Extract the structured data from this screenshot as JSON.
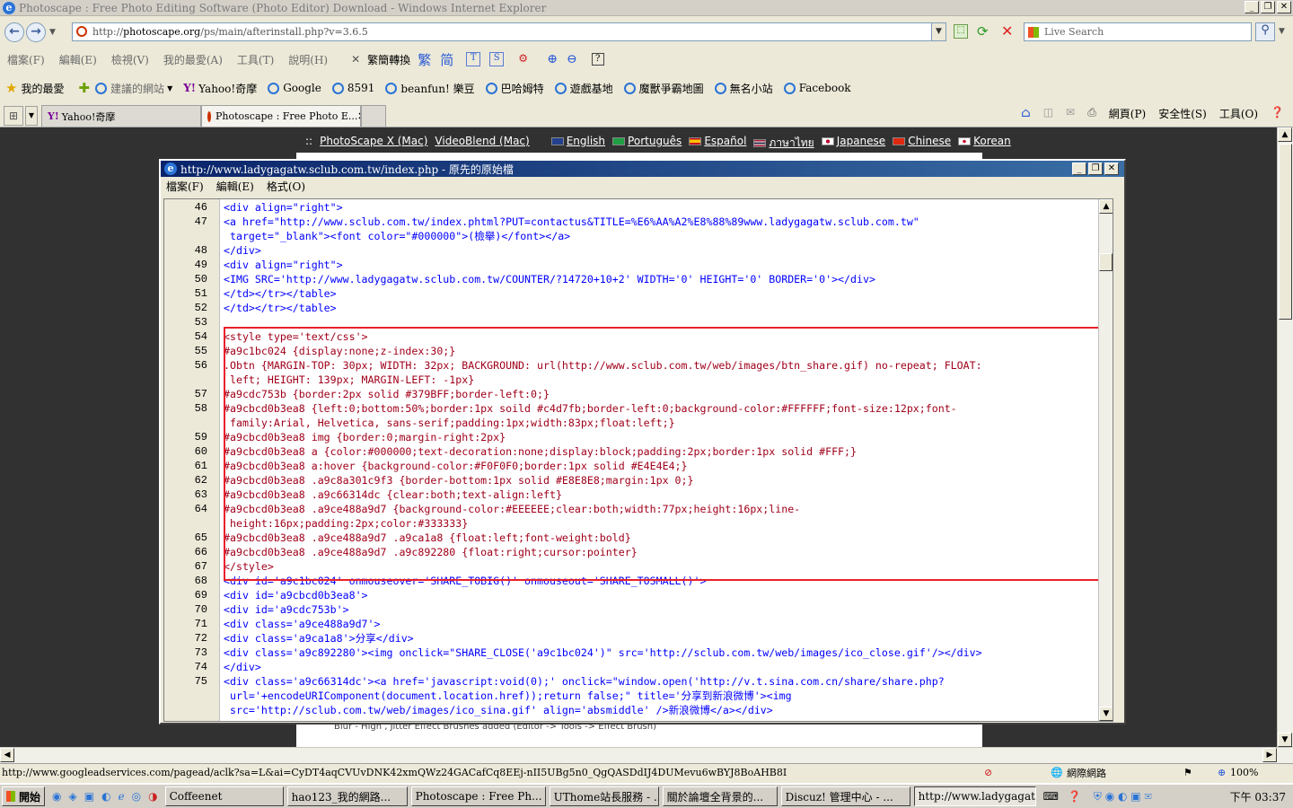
{
  "window": {
    "title": "Photoscape : Free Photo Editing Software (Photo Editor) Download - Windows Internet Explorer"
  },
  "address": {
    "url_prefix": "http://",
    "url_host": "photoscape.org",
    "url_path": "/ps/main/afterinstall.php?v=3.6.5",
    "search_placeholder": "Live Search"
  },
  "menubar": {
    "items": [
      "檔案(F)",
      "編輯(E)",
      "檢視(V)",
      "我的最愛(A)",
      "工具(T)",
      "說明(H)"
    ],
    "translate": "繁簡轉換",
    "trad": "繁",
    "simp": "简"
  },
  "favorites": {
    "label": "我的最愛",
    "items": [
      "建議的網站",
      "Yahoo!奇摩",
      "Google",
      "8591",
      "beanfun! 樂豆",
      "巴哈姆特",
      "遊戲基地",
      "魔獸爭霸地圖",
      "無名小站",
      "Facebook"
    ]
  },
  "tabs": [
    {
      "label": "Yahoo!奇摩"
    },
    {
      "label": "Photoscape : Free Photo E..."
    }
  ],
  "tools": {
    "page": "網頁(P)",
    "safety": "安全性(S)",
    "tools": "工具(O)"
  },
  "page": {
    "prefix": "::",
    "links": [
      "PhotoScape X (Mac)",
      "VideoBlend (Mac)"
    ],
    "languages": [
      "English",
      "Português",
      "Español",
      "ภาษาไทย",
      "Japanese",
      "Chinese",
      "Korean"
    ],
    "bottom_text": "Blur - High , Jitter  Effect Brushes added (Editor -> Tools -> Effect Brush)"
  },
  "source_window": {
    "title": "http://www.ladygagatw.sclub.com.tw/index.php - 原先的原始檔",
    "menu": [
      "檔案(F)",
      "編輯(E)",
      "格式(O)"
    ],
    "lines": [
      {
        "n": "46",
        "c": "<div align=\"right\">"
      },
      {
        "n": "47",
        "c": "<a href=\"http://www.sclub.com.tw/index.phtml?PUT=contactus&TITLE=%E6%AA%A2%E8%88%89www.ladygagatw.sclub.com.tw\""
      },
      {
        "n": "",
        "c": " target=\"_blank\"><font color=\"#000000\">(檢舉)</font></a>"
      },
      {
        "n": "48",
        "c": "</div>"
      },
      {
        "n": "49",
        "c": "<div align=\"right\">"
      },
      {
        "n": "50",
        "c": "<IMG SRC='http://www.ladygagatw.sclub.com.tw/COUNTER/?14720+10+2' WIDTH='0' HEIGHT='0' BORDER='0'></div>"
      },
      {
        "n": "51",
        "c": "</td></tr></table>"
      },
      {
        "n": "52",
        "c": "</td></tr></table>"
      },
      {
        "n": "53",
        "c": ""
      },
      {
        "n": "54",
        "c": "<style type='text/css'>"
      },
      {
        "n": "55",
        "c": "#a9c1bc024 {display:none;z-index:30;}"
      },
      {
        "n": "56",
        "c": ".Obtn {MARGIN-TOP: 30px; WIDTH: 32px; BACKGROUND: url(http://www.sclub.com.tw/web/images/btn_share.gif) no-repeat; FLOAT:"
      },
      {
        "n": "",
        "c": " left; HEIGHT: 139px; MARGIN-LEFT: -1px}"
      },
      {
        "n": "57",
        "c": "#a9cdc753b {border:2px solid #379BFF;border-left:0;}"
      },
      {
        "n": "58",
        "c": "#a9cbcd0b3ea8 {left:0;bottom:50%;border:1px soild #c4d7fb;border-left:0;background-color:#FFFFFF;font-size:12px;font-"
      },
      {
        "n": "",
        "c": " family:Arial, Helvetica, sans-serif;padding:1px;width:83px;float:left;}"
      },
      {
        "n": "59",
        "c": "#a9cbcd0b3ea8 img {border:0;margin-right:2px}"
      },
      {
        "n": "60",
        "c": "#a9cbcd0b3ea8 a {color:#000000;text-decoration:none;display:block;padding:2px;border:1px solid #FFF;}"
      },
      {
        "n": "61",
        "c": "#a9cbcd0b3ea8 a:hover {background-color:#F0F0F0;border:1px solid #E4E4E4;}"
      },
      {
        "n": "62",
        "c": "#a9cbcd0b3ea8 .a9c8a301c9f3 {border-bottom:1px solid #E8E8E8;margin:1px 0;}"
      },
      {
        "n": "63",
        "c": "#a9cbcd0b3ea8 .a9c66314dc {clear:both;text-align:left}"
      },
      {
        "n": "64",
        "c": "#a9cbcd0b3ea8 .a9ce488a9d7 {background-color:#EEEEEE;clear:both;width:77px;height:16px;line-"
      },
      {
        "n": "",
        "c": " height:16px;padding:2px;color:#333333}"
      },
      {
        "n": "65",
        "c": "#a9cbcd0b3ea8 .a9ce488a9d7 .a9ca1a8 {float:left;font-weight:bold}"
      },
      {
        "n": "66",
        "c": "#a9cbcd0b3ea8 .a9ce488a9d7 .a9c892280 {float:right;cursor:pointer}"
      },
      {
        "n": "67",
        "c": "</style>"
      },
      {
        "n": "68",
        "c": "<div id='a9c1bc024' onmouseover='SHARE_TOBIG()' onmouseout='SHARE_TOSMALL()'>"
      },
      {
        "n": "69",
        "c": "<div id='a9cbcd0b3ea8'>"
      },
      {
        "n": "70",
        "c": "<div id='a9cdc753b'>"
      },
      {
        "n": "71",
        "c": "<div class='a9ce488a9d7'>"
      },
      {
        "n": "72",
        "c": "<div class='a9ca1a8'>分享</div>"
      },
      {
        "n": "73",
        "c": "<div class='a9c892280'><img onclick=\"SHARE_CLOSE('a9c1bc024')\" src='http://sclub.com.tw/web/images/ico_close.gif'/></div>"
      },
      {
        "n": "74",
        "c": "</div>"
      },
      {
        "n": "75",
        "c": "<div class='a9c66314dc'><a href='javascript:void(0);' onclick=\"window.open('http://v.t.sina.com.cn/share/share.php?"
      },
      {
        "n": "",
        "c": " url='+encodeURIComponent(document.location.href));return false;\" title='分享到新浪微博'><img"
      },
      {
        "n": "",
        "c": " src='http://sclub.com.tw/web/images/ico_sina.gif' align='absmiddle' />新浪微博</a></div>"
      }
    ]
  },
  "status": {
    "url": "http://www.googleadservices.com/pagead/aclk?sa=L&ai=CyDT4aqCVUvDNK42xmQWz24GACafCq8EEj-nII5UBg5n0_QgQASDdIJ4DUMevu6wBYJ8BoAHB8I",
    "zone": "網際網路",
    "zoom": "100%"
  },
  "taskbar": {
    "start": "開始",
    "items": [
      "Coffeenet",
      "hao123_我的網路...",
      "Photoscape : Free Ph...",
      "UThome站長服務 - ...",
      "關於論壇全背景的...",
      "Discuz! 管理中心 - ...",
      "http://www.ladygagat..."
    ],
    "clock": "下午 03:37"
  }
}
